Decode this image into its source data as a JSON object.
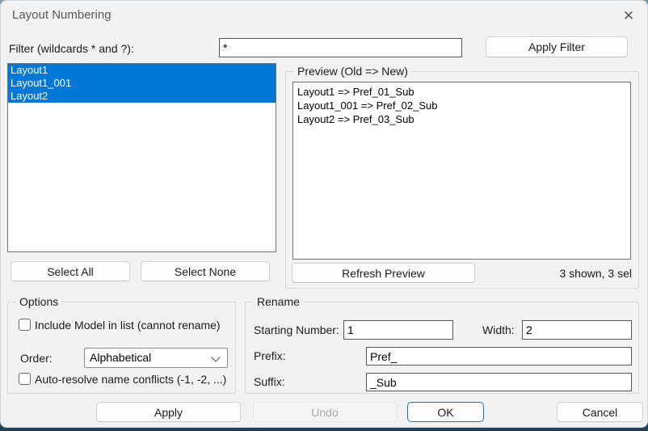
{
  "dialog": {
    "title": "Layout Numbering",
    "close_glyph": "✕"
  },
  "filter": {
    "label": "Filter (wildcards * and ?):",
    "value": "*",
    "apply_button": "Apply Filter"
  },
  "layout_list": {
    "items": [
      {
        "name": "Layout1",
        "selected": true
      },
      {
        "name": "Layout1_001",
        "selected": true
      },
      {
        "name": "Layout2",
        "selected": true
      }
    ]
  },
  "list_actions": {
    "select_all": "Select All",
    "select_none": "Select None"
  },
  "preview": {
    "group_label": "Preview (Old => New)",
    "items": [
      "Layout1 => Pref_01_Sub",
      "Layout1_001 => Pref_02_Sub",
      "Layout2 => Pref_03_Sub"
    ],
    "refresh_button": "Refresh Preview",
    "count_text": "3 shown, 3 sel"
  },
  "options": {
    "group_label": "Options",
    "include_model": {
      "label": "Include Model in list (cannot rename)",
      "checked": false
    },
    "order": {
      "label": "Order:",
      "value": "Alphabetical"
    },
    "auto_resolve": {
      "label": "Auto-resolve name conflicts (-1, -2, ...)",
      "checked": false
    }
  },
  "rename": {
    "group_label": "Rename",
    "starting_number": {
      "label": "Starting Number:",
      "value": "1"
    },
    "width": {
      "label": "Width:",
      "value": "2"
    },
    "prefix": {
      "label": "Prefix:",
      "value": "Pref_"
    },
    "suffix": {
      "label": "Suffix:",
      "value": "_Sub"
    }
  },
  "footer": {
    "apply": "Apply",
    "undo": "Undo",
    "ok": "OK",
    "cancel": "Cancel"
  },
  "colors": {
    "selection": "#0078d7",
    "focus_border": "#2272b9",
    "dialog_bg": "#f2f2f2"
  }
}
